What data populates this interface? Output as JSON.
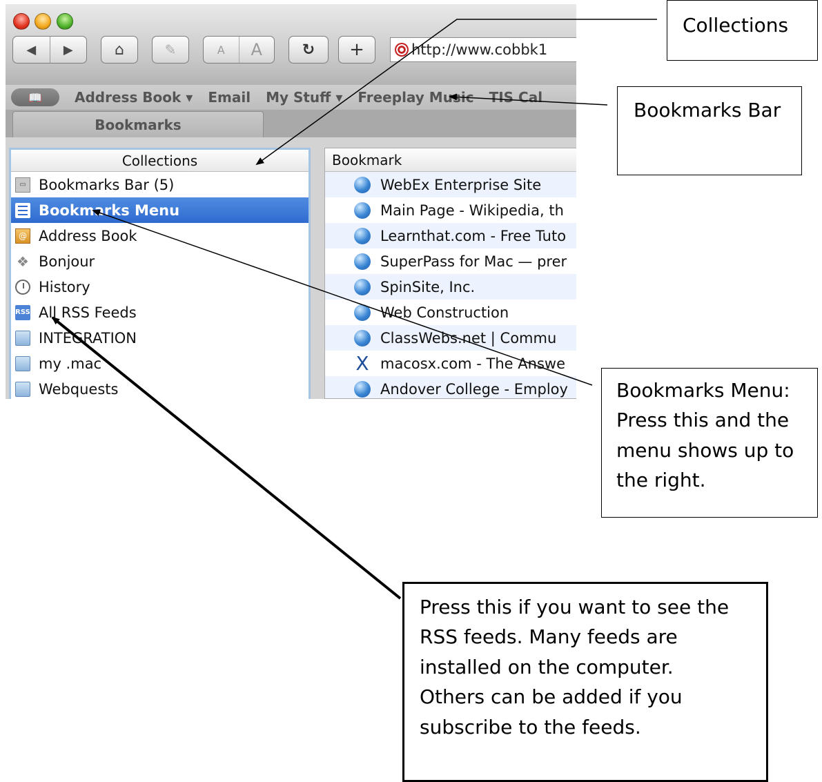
{
  "toolbar": {
    "url": "http://www.cobbk1",
    "text_small": "A",
    "text_large": "A",
    "back": "◀",
    "forward": "▶",
    "home": "⌂",
    "reload": "↻",
    "add": "+"
  },
  "bookmarks_bar": {
    "items": [
      "Address Book ▾",
      "Email",
      "My Stuff ▾",
      "Freeplay Music",
      "TIS Cal"
    ]
  },
  "tab": {
    "label": "Bookmarks"
  },
  "collections": {
    "header": "Collections",
    "items": [
      {
        "label": "Bookmarks Bar (5)",
        "icon": "bookmarks-bar-icon"
      },
      {
        "label": "Bookmarks Menu",
        "icon": "bookmarks-menu-icon",
        "selected": true
      },
      {
        "label": "Address Book",
        "icon": "address-book-icon"
      },
      {
        "label": "Bonjour",
        "icon": "bonjour-icon"
      },
      {
        "label": "History",
        "icon": "history-icon"
      },
      {
        "label": "All RSS Feeds",
        "icon": "rss-icon",
        "icon_text": "RSS"
      },
      {
        "label": "INTEGRATION",
        "icon": "folder-icon"
      },
      {
        "label": "my .mac",
        "icon": "folder-icon"
      },
      {
        "label": "Webquests",
        "icon": "folder-icon"
      }
    ]
  },
  "bookmark_list": {
    "header": "Bookmark",
    "items": [
      "WebEx Enterprise Site",
      "Main Page - Wikipedia, th",
      "Learnthat.com - Free Tuto",
      "SuperPass for Mac — prer",
      "SpinSite, Inc.",
      "Web Construction",
      "ClassWebs.net  |  Commu",
      "macosx.com - The Answe",
      "Andover College - Employ"
    ]
  },
  "callouts": {
    "collections": "Collections",
    "bookmarks_bar": "Bookmarks Bar",
    "bookmarks_menu": [
      "Bookmarks Menu:",
      "Press this and the",
      "menu shows up to",
      "the right."
    ],
    "rss": [
      "Press this if you want to see the",
      "RSS feeds.  Many feeds are",
      "installed on the computer.",
      "Others can be added if you",
      "subscribe to the feeds."
    ]
  }
}
